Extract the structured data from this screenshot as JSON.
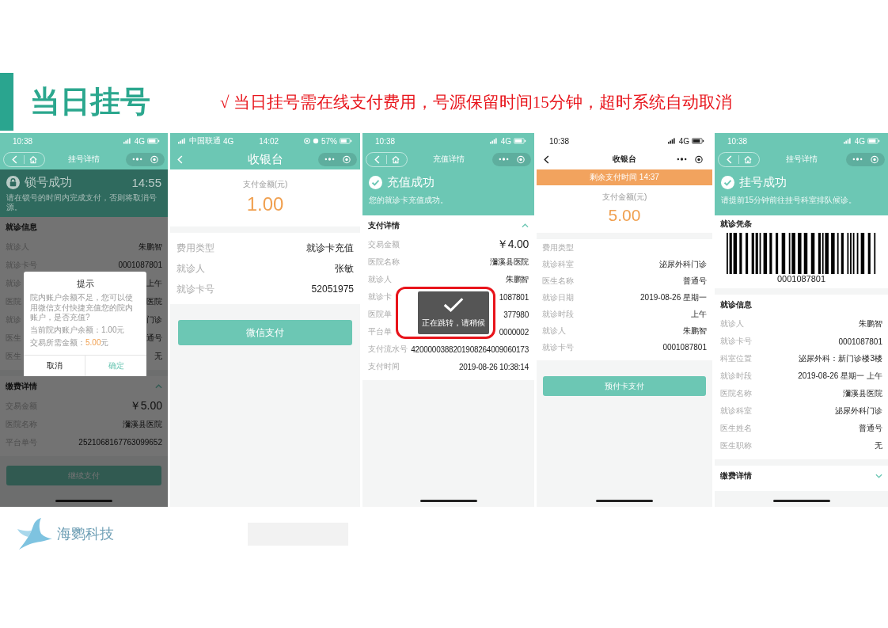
{
  "header": {
    "title": "当日挂号",
    "note": "√  当日挂号需在线支付费用，号源保留时间15分钟，超时系统自动取消"
  },
  "phones": [
    {
      "status": {
        "time": "10:38",
        "network": "4G"
      },
      "nav": {
        "title": "挂号详情",
        "home": true
      },
      "dimmed": true,
      "home_indicator": true,
      "blocks": [
        {
          "kind": "lock_banner",
          "title": "锁号成功",
          "timer": "14:55",
          "text": "请在锁号的时间内完成支付，否则将取消号源。"
        },
        {
          "kind": "section",
          "title": "就诊信息",
          "rows": [
            {
              "label": "就诊人",
              "value": "朱鹏智"
            },
            {
              "label": "就诊卡号",
              "value": "0001087801"
            },
            {
              "label": "就诊",
              "value": "上午"
            },
            {
              "label": "医院",
              "value": "医院"
            },
            {
              "label": "就诊",
              "value": "门诊"
            },
            {
              "label": "医生",
              "value": "通号"
            },
            {
              "label": "医生",
              "value": "无"
            }
          ]
        },
        {
          "kind": "section",
          "title": "缴费详情",
          "expanded": true,
          "total": {
            "label": "交易金额",
            "value": "￥5.00"
          },
          "rows": [
            {
              "label": "医院名称",
              "value": "瀰溪县医院"
            },
            {
              "label": "平台单号",
              "value": "2521068167763099652"
            }
          ]
        },
        {
          "kind": "button",
          "label": "继续支付"
        }
      ],
      "dialog": {
        "title": "提示",
        "text": "院内账户余额不足，您可以使用微信支付快捷充值您的院内账户，是否充值?",
        "balance": "当前院内账户余额：1.00元",
        "due_label": "交易所需金额：",
        "due_amount": "5.00",
        "due_unit": "元",
        "cancel": "取消",
        "confirm": "确定"
      }
    },
    {
      "status": {
        "time": "14:02",
        "carrier": "中国联通",
        "network": "4G",
        "battery": "57%"
      },
      "nav": {
        "title": "收银台",
        "home": false
      },
      "dimmed": false,
      "home_indicator": false,
      "blocks": [
        {
          "kind": "amount",
          "label": "支付金额(元)",
          "value": "1.00"
        },
        {
          "kind": "section",
          "rows": [
            {
              "label": "费用类型",
              "value": "就诊卡充值"
            },
            {
              "label": "就诊人",
              "value": "张敏"
            },
            {
              "label": "就诊卡号",
              "value": "52051975"
            }
          ]
        },
        {
          "kind": "button",
          "label": "微信支付"
        }
      ]
    },
    {
      "status": {
        "time": "10:38",
        "network": "4G"
      },
      "nav": {
        "title": "充值详情",
        "home": true
      },
      "dimmed": false,
      "home_indicator": true,
      "blocks": [
        {
          "kind": "success_banner",
          "title": "充值成功",
          "text": "您的就诊卡充值成功。"
        },
        {
          "kind": "section",
          "title": "支付详情",
          "expanded": true,
          "total": {
            "label": "交易金额",
            "value": "￥4.00"
          },
          "rows": [
            {
              "label": "医院名称",
              "value": "瀰溪县医院"
            },
            {
              "label": "就诊人",
              "value": "朱鹏智"
            },
            {
              "label": "就诊卡",
              "value": "1087801"
            },
            {
              "label": "医院单",
              "value": "377980"
            },
            {
              "label": "平台单",
              "value": "0000002"
            },
            {
              "label": "支付流水号",
              "value": "4200000388201908264009060173"
            },
            {
              "label": "支付时间",
              "value": "2019-08-26 10:38:14"
            }
          ]
        }
      ],
      "toast": {
        "text": "正在跳转，请稍候",
        "highlighted": true
      }
    },
    {
      "status": {
        "time": "10:38",
        "network": "4G"
      },
      "nav": {
        "title": "收银台",
        "home": false
      },
      "dimmed": false,
      "home_indicator": true,
      "blocks": [
        {
          "kind": "notice",
          "text": "剩余支付时间 14:37"
        },
        {
          "kind": "amount",
          "label": "支付金额(元)",
          "value": "5.00"
        },
        {
          "kind": "section",
          "rows": [
            {
              "label": "费用类型"
            },
            {
              "label": "就诊科室",
              "value": "泌尿外科门诊"
            },
            {
              "label": "医生名称",
              "value": "普通号"
            },
            {
              "label": "就诊日期",
              "value": "2019-08-26 星期一"
            },
            {
              "label": "就诊时段",
              "value": "上午"
            },
            {
              "label": "就诊人",
              "value": "朱鹏智"
            },
            {
              "label": "就诊卡号",
              "value": "0001087801"
            }
          ]
        },
        {
          "kind": "button",
          "label": "预付卡支付"
        }
      ]
    },
    {
      "status": {
        "time": "10:38",
        "network": "4G"
      },
      "nav": {
        "title": "挂号详情",
        "home": true
      },
      "dimmed": false,
      "home_indicator": true,
      "blocks": [
        {
          "kind": "success_banner",
          "title": "挂号成功",
          "text": "请提前15分钟前往挂号科室排队候诊。"
        },
        {
          "kind": "barcode",
          "title": "就诊凭条",
          "number": "0001087801"
        },
        {
          "kind": "section",
          "title": "就诊信息",
          "rows": [
            {
              "label": "就诊人",
              "value": "朱鹏智"
            },
            {
              "label": "就诊卡号",
              "value": "0001087801"
            },
            {
              "label": "科室位置",
              "value": "泌尿外科：新门诊楼3楼"
            },
            {
              "label": "就诊时段",
              "value": "2019-08-26 星期一 上午"
            },
            {
              "label": "医院名称",
              "value": "瀰溪县医院"
            },
            {
              "label": "就诊科室",
              "value": "泌尿外科门诊"
            },
            {
              "label": "医生姓名",
              "value": "普通号"
            },
            {
              "label": "医生职称",
              "value": "无"
            }
          ]
        },
        {
          "kind": "section",
          "title": "缴费详情",
          "expanded": false
        }
      ]
    }
  ],
  "footer": {
    "brand": "海鹦科技"
  }
}
